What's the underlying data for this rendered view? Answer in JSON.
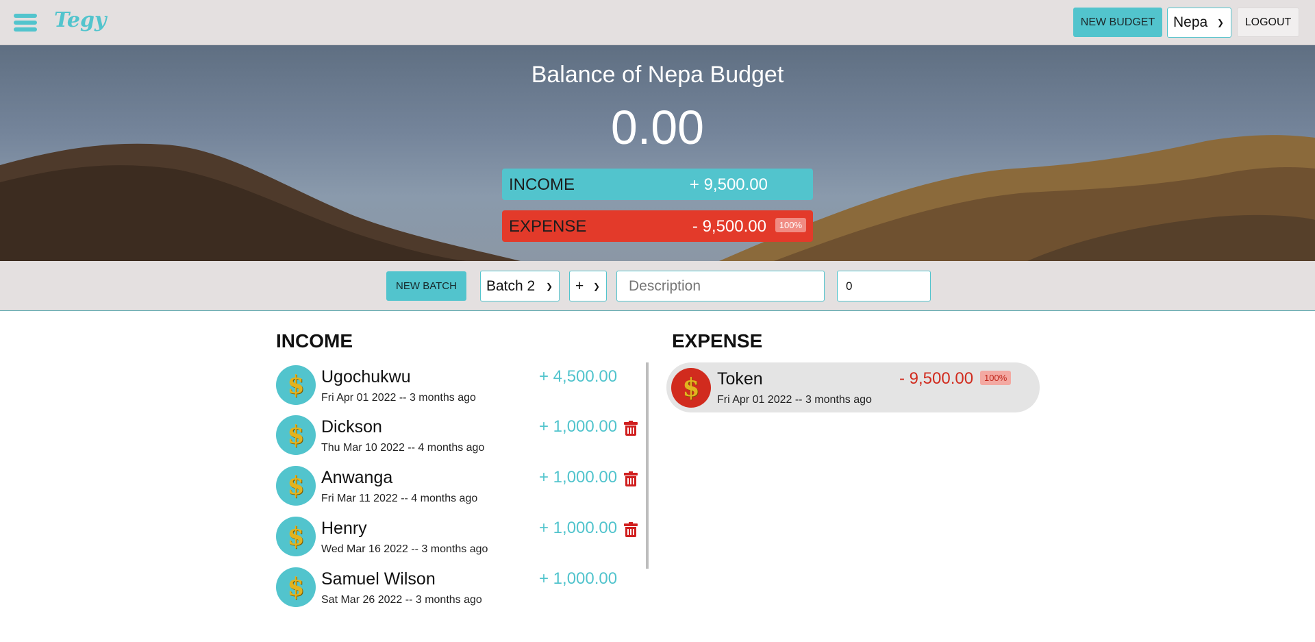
{
  "header": {
    "logo": "Tegy",
    "new_budget_label": "NEW BUDGET",
    "budget_selected": "Nepa",
    "logout_label": "LOGOUT"
  },
  "hero": {
    "title": "Balance of Nepa Budget",
    "balance": "0.00",
    "income_label": "INCOME",
    "income_value": "+ 9,500.00",
    "expense_label": "EXPENSE",
    "expense_value": "- 9,500.00",
    "expense_percent": "100%"
  },
  "add_form": {
    "new_batch_label": "NEW BATCH",
    "batch_selected": "Batch 2",
    "type_selected": "+",
    "description_placeholder": "Description",
    "value": "0"
  },
  "income": {
    "title": "INCOME",
    "items": [
      {
        "name": "Ugochukwu",
        "date": "Fri Apr 01 2022 -- 3 months ago",
        "amount": "+ 4,500.00",
        "deletable": false
      },
      {
        "name": "Dickson",
        "date": "Thu Mar 10 2022 -- 4 months ago",
        "amount": "+ 1,000.00",
        "deletable": true
      },
      {
        "name": "Anwanga",
        "date": "Fri Mar 11 2022 -- 4 months ago",
        "amount": "+ 1,000.00",
        "deletable": true
      },
      {
        "name": "Henry",
        "date": "Wed Mar 16 2022 -- 3 months ago",
        "amount": "+ 1,000.00",
        "deletable": true
      },
      {
        "name": "Samuel Wilson",
        "date": "Sat Mar 26 2022 -- 3 months ago",
        "amount": "+ 1,000.00",
        "deletable": false
      }
    ]
  },
  "expense": {
    "title": "EXPENSE",
    "items": [
      {
        "name": "Token",
        "date": "Fri Apr 01 2022 -- 3 months ago",
        "amount": "- 9,500.00",
        "percent": "100%"
      }
    ]
  },
  "icons": {
    "avatar_symbol": "$"
  },
  "colors": {
    "accent": "#52c4cd",
    "expense": "#e33a2a",
    "header_bg": "#e4e0e0"
  }
}
